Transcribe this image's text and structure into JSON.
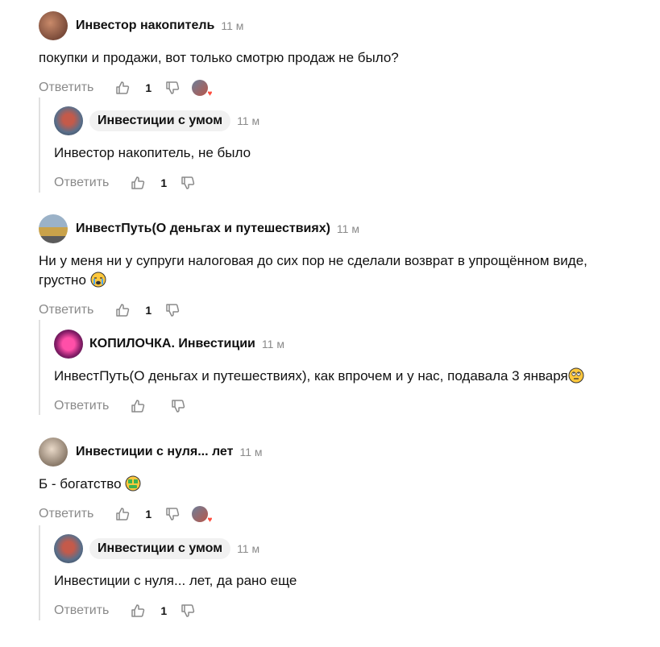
{
  "reply_label": "Ответить",
  "comments": [
    {
      "author": "Инвестор накопитель",
      "time": "11 м",
      "text": "покупки и продажи, вот только смотрю продаж не было?",
      "likes": "1"
    },
    {
      "author": "Инвестиции с умом",
      "time": "11 м",
      "text": "Инвестор накопитель, не было",
      "likes": "1"
    },
    {
      "author": "ИнвестПуть(О деньгах и путешествиях)",
      "time": "11 м",
      "text": "Ни у меня ни у супруги налоговая до сих пор не сделали возврат в упрощённом виде,",
      "text2": "грустно",
      "likes": "1"
    },
    {
      "author": "КОПИЛОЧКА. Инвестиции",
      "time": "11 м",
      "text": "ИнвестПуть(О деньгах и путешествиях), как впрочем и у нас, подавала 3 января",
      "likes": ""
    },
    {
      "author": "Инвестиции с нуля... лет",
      "time": "11 м",
      "text": "Б - богатство",
      "likes": "1"
    },
    {
      "author": "Инвестиции с умом",
      "time": "11 м",
      "text": "Инвестиции с нуля... лет, да рано еще",
      "likes": "1"
    }
  ],
  "icons": {
    "like": "thumbs-up-icon",
    "dislike": "thumbs-down-icon",
    "reaction": "reaction-avatar-heart-icon"
  },
  "colors": {
    "muted": "#8a8a8a",
    "pill": "#f1f1f1",
    "thread": "#e0e0e0",
    "heart": "#ff4a3b"
  }
}
